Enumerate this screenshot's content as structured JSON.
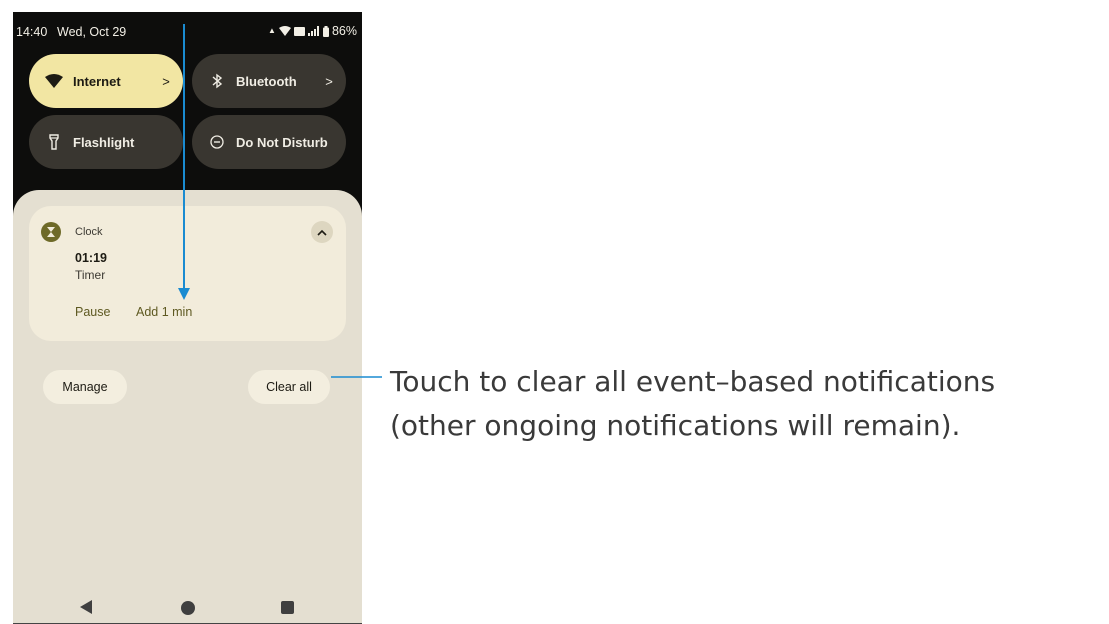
{
  "status_bar": {
    "time": "14:40",
    "date": "Wed, Oct 29",
    "battery": "86%"
  },
  "tiles": [
    {
      "label": "Internet",
      "state": "on",
      "icon": "wifi-icon",
      "chevron": ">"
    },
    {
      "label": "Bluetooth",
      "state": "off",
      "icon": "bluetooth-icon",
      "chevron": ">"
    },
    {
      "label": "Flashlight",
      "state": "off",
      "icon": "flashlight-icon"
    },
    {
      "label": "Do Not Disturb",
      "state": "off",
      "icon": "do-not-disturb-icon"
    }
  ],
  "notification": {
    "app_name": "Clock",
    "app_icon": "hourglass-icon",
    "title": "01:19",
    "text": "Timer",
    "actions": [
      "Pause",
      "Add 1 min"
    ]
  },
  "buttons": {
    "manage": "Manage",
    "clear_all": "Clear all"
  },
  "nav": [
    "back-icon",
    "home-icon",
    "recents-icon"
  ],
  "callout": {
    "line1": "Touch to clear all event–based notifications",
    "line2": "(other ongoing notifications will remain)."
  },
  "colors": {
    "tile_on": "#f2e6a3",
    "tile_off": "#393630",
    "shade": "#e4dfd1",
    "card": "#f2ecdb",
    "accent_action": "#5e5921",
    "annotation_line": "#1a8bd1"
  }
}
